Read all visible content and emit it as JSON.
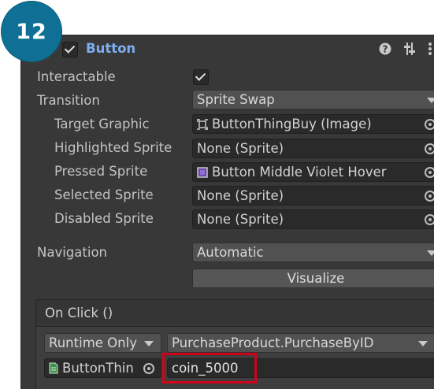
{
  "step_badge": "12",
  "component": {
    "enabled": true,
    "title": "Button",
    "icons": [
      "help-icon",
      "preset-icon",
      "more-menu-icon"
    ]
  },
  "properties": {
    "interactable_label": "Interactable",
    "interactable_checked": true,
    "transition_label": "Transition",
    "transition_value": "Sprite Swap",
    "target_graphic_label": "Target Graphic",
    "target_graphic_value": "ButtonThingBuy (Image)",
    "highlighted_label": "Highlighted Sprite",
    "highlighted_value": "None (Sprite)",
    "pressed_label": "Pressed Sprite",
    "pressed_value": "Button Middle Violet Hover",
    "selected_label": "Selected Sprite",
    "selected_value": "None (Sprite)",
    "disabled_label": "Disabled Sprite",
    "disabled_value": "None (Sprite)",
    "navigation_label": "Navigation",
    "navigation_value": "Automatic",
    "visualize_label": "Visualize"
  },
  "on_click": {
    "header": "On Click ()",
    "call_state": "Runtime Only",
    "function": "PurchaseProduct.PurchaseByID",
    "target_object": "ButtonThin",
    "argument": "coin_5000"
  },
  "colors": {
    "panel_bg": "#383838",
    "badge_bg": "#0f6f95",
    "title_blue": "#7eaef2",
    "highlight_red": "#d0021b"
  }
}
